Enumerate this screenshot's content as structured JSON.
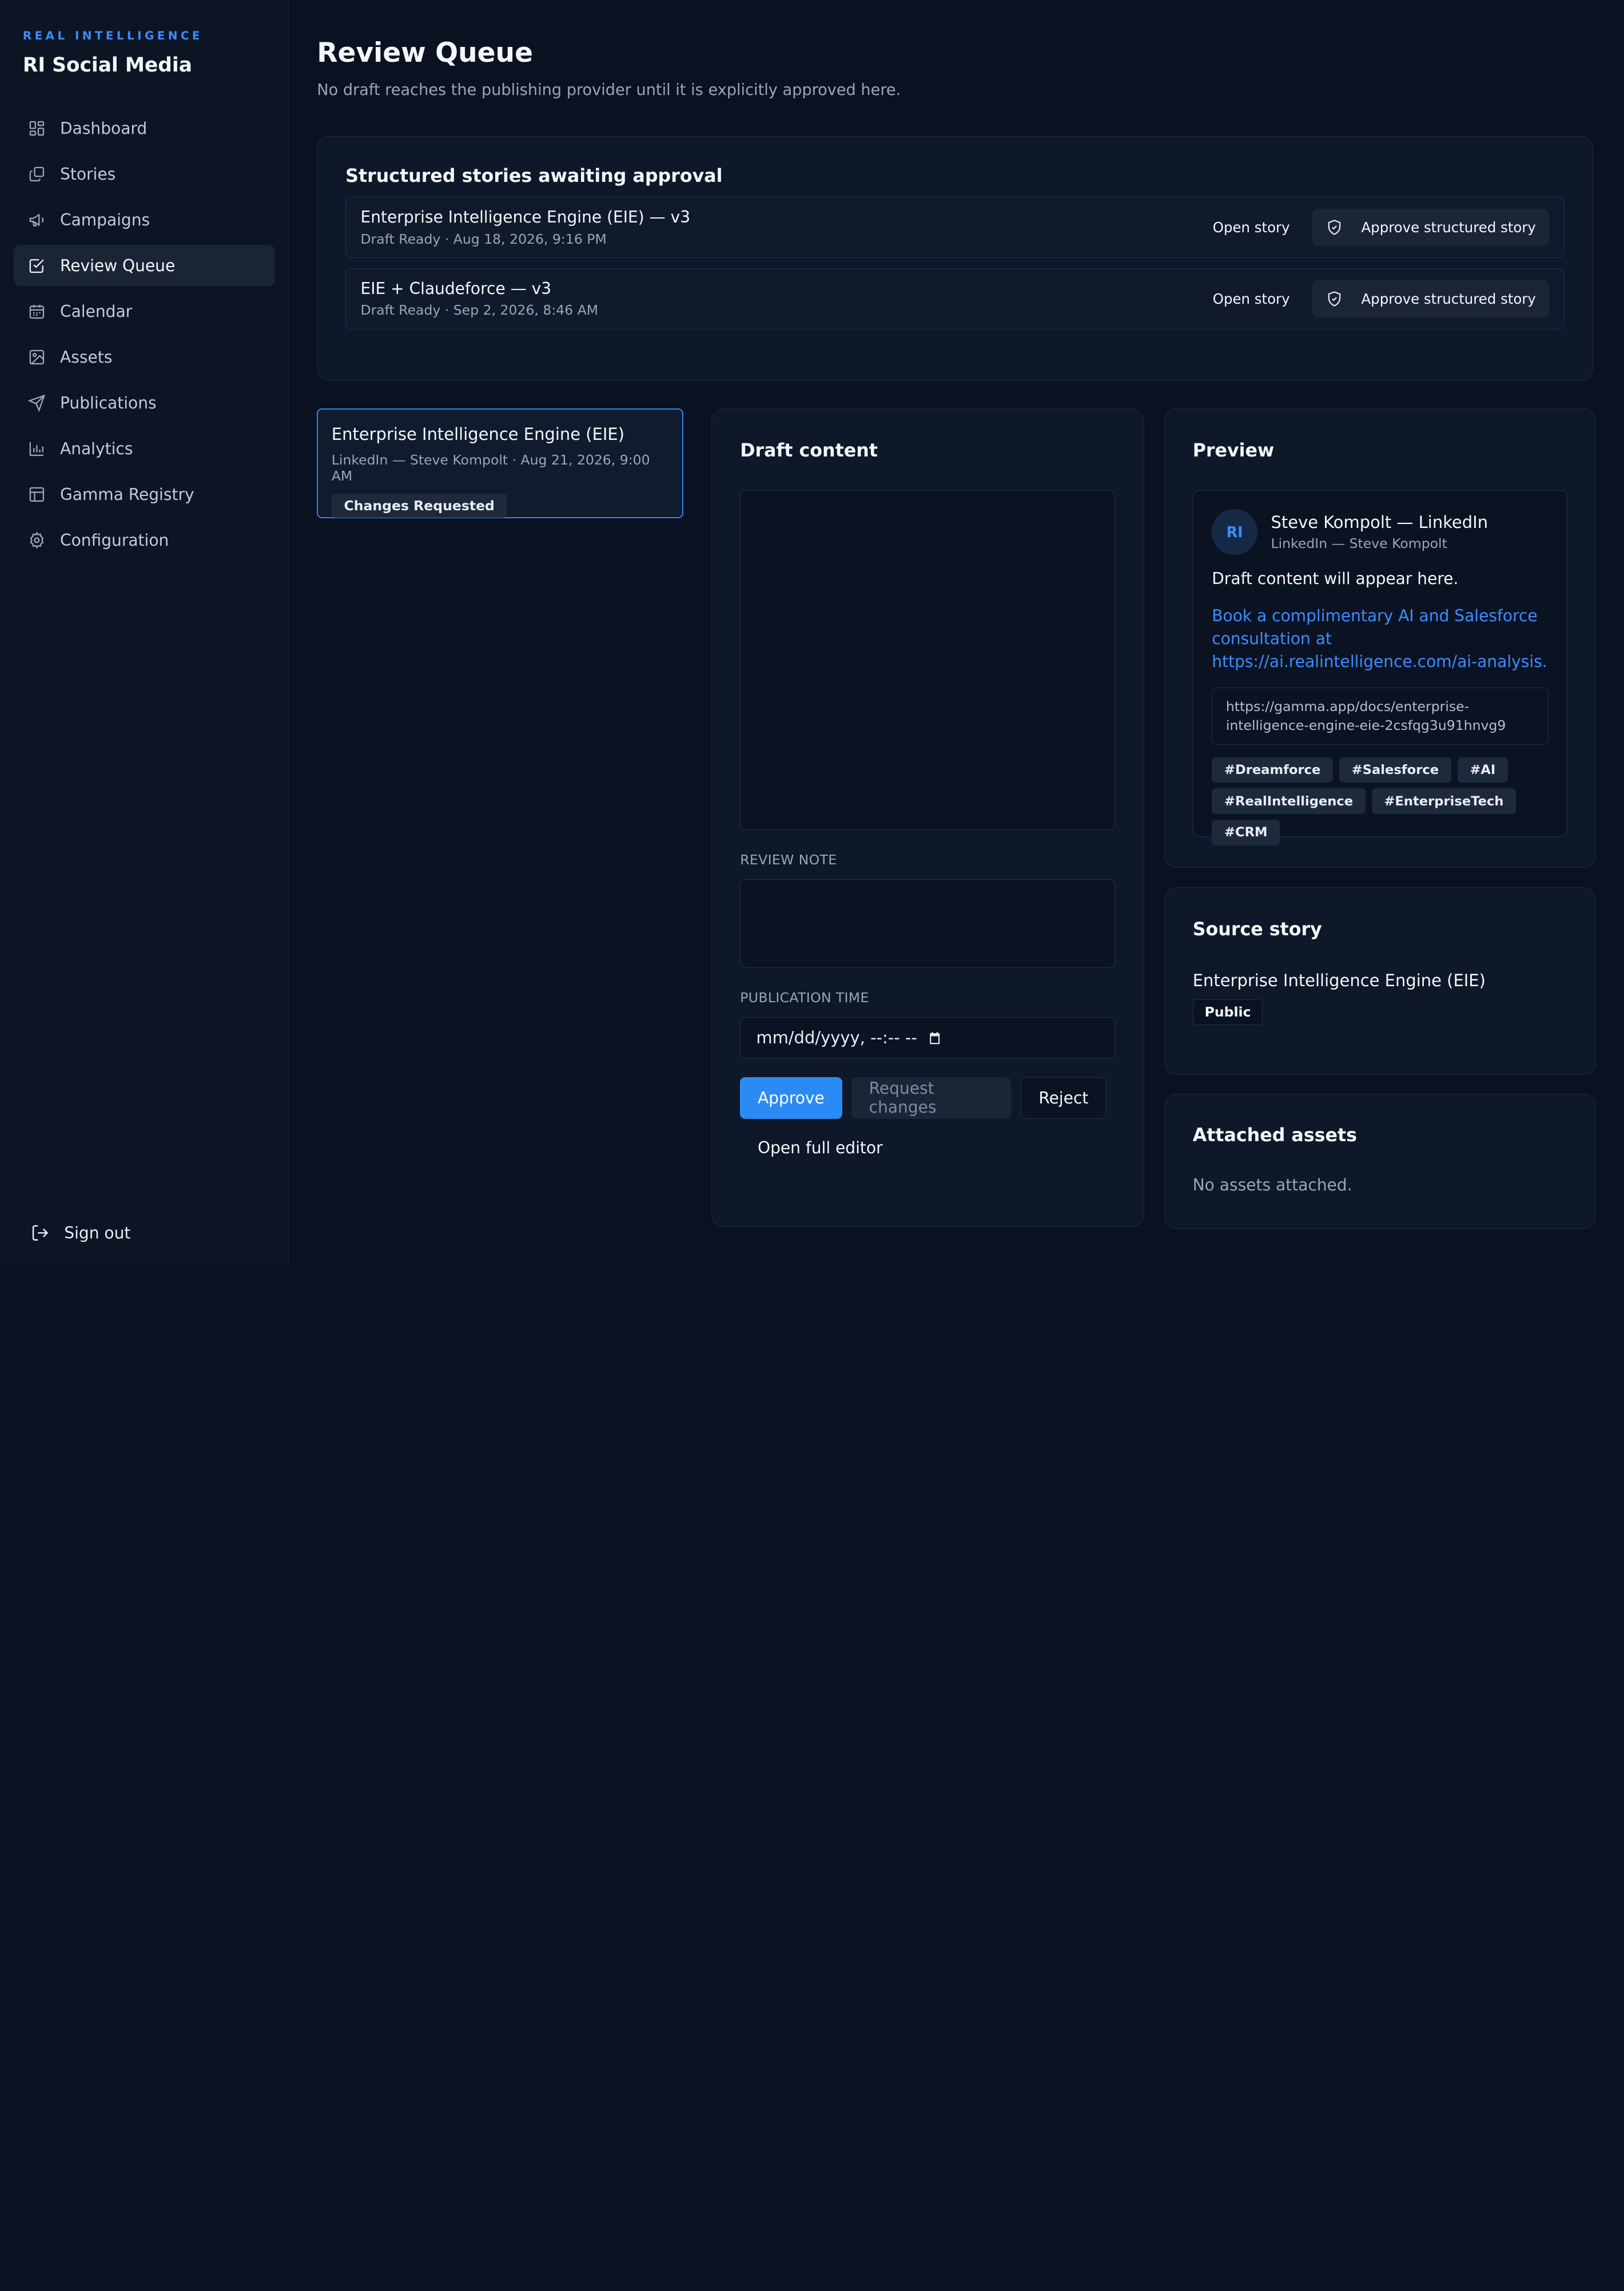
{
  "brand": {
    "eyebrow": "REAL INTELLIGENCE",
    "title": "RI Social Media"
  },
  "sidebar": {
    "items": [
      {
        "label": "Dashboard",
        "icon": "dashboard-icon"
      },
      {
        "label": "Stories",
        "icon": "stories-icon"
      },
      {
        "label": "Campaigns",
        "icon": "megaphone-icon"
      },
      {
        "label": "Review Queue",
        "icon": "check-square-icon",
        "active": true
      },
      {
        "label": "Calendar",
        "icon": "calendar-icon"
      },
      {
        "label": "Assets",
        "icon": "image-icon"
      },
      {
        "label": "Publications",
        "icon": "send-icon"
      },
      {
        "label": "Analytics",
        "icon": "bar-chart-icon"
      },
      {
        "label": "Gamma Registry",
        "icon": "table-icon"
      },
      {
        "label": "Configuration",
        "icon": "gear-icon"
      }
    ],
    "sign_out": "Sign out"
  },
  "page": {
    "title": "Review Queue",
    "subtitle": "No draft reaches the publishing provider until it is explicitly approved here."
  },
  "structured_stories": {
    "title": "Structured stories awaiting approval",
    "open_label": "Open story",
    "approve_label": "Approve structured story",
    "rows": [
      {
        "name": "Enterprise Intelligence Engine (EIE) — v3",
        "meta": "Draft Ready · Aug 18, 2026, 9:16 PM"
      },
      {
        "name": "EIE + Claudeforce — v3",
        "meta": "Draft Ready · Sep 2, 2026, 8:46 AM"
      }
    ]
  },
  "queue": {
    "items": [
      {
        "title": "Enterprise Intelligence Engine (EIE)",
        "meta": "LinkedIn — Steve Kompolt · Aug 21, 2026, 9:00 AM",
        "status": "Changes Requested"
      }
    ]
  },
  "draft": {
    "title": "Draft content",
    "content_value": "",
    "review_note_label": "REVIEW NOTE",
    "review_note_value": "",
    "publication_time_label": "PUBLICATION TIME",
    "publication_time_placeholder": "mm/dd/yyyy, --:-- --",
    "approve": "Approve",
    "request_changes": "Request changes",
    "reject": "Reject",
    "open_full_editor": "Open full editor"
  },
  "preview": {
    "title": "Preview",
    "avatar_initials": "RI",
    "author": "Steve Kompolt — LinkedIn",
    "author_sub": "LinkedIn — Steve Kompolt",
    "body": "Draft content will appear here.",
    "cta": "Book a complimentary AI and Salesforce consultation at https://ai.realintelligence.com/ai-analysis.",
    "url": "https://gamma.app/docs/enterprise-intelligence-engine-eie-2csfqg3u91hnvg9",
    "tags": [
      "#Dreamforce",
      "#Salesforce",
      "#AI",
      "#RealIntelligence",
      "#EnterpriseTech",
      "#CRM"
    ]
  },
  "source_story": {
    "title": "Source story",
    "name": "Enterprise Intelligence Engine (EIE)",
    "visibility": "Public"
  },
  "attached_assets": {
    "title": "Attached assets",
    "empty": "No assets attached."
  },
  "colors": {
    "accent": "#2b8bf5",
    "background": "#0a1120",
    "sidebar": "#0d1524",
    "card": "#0f1828"
  }
}
